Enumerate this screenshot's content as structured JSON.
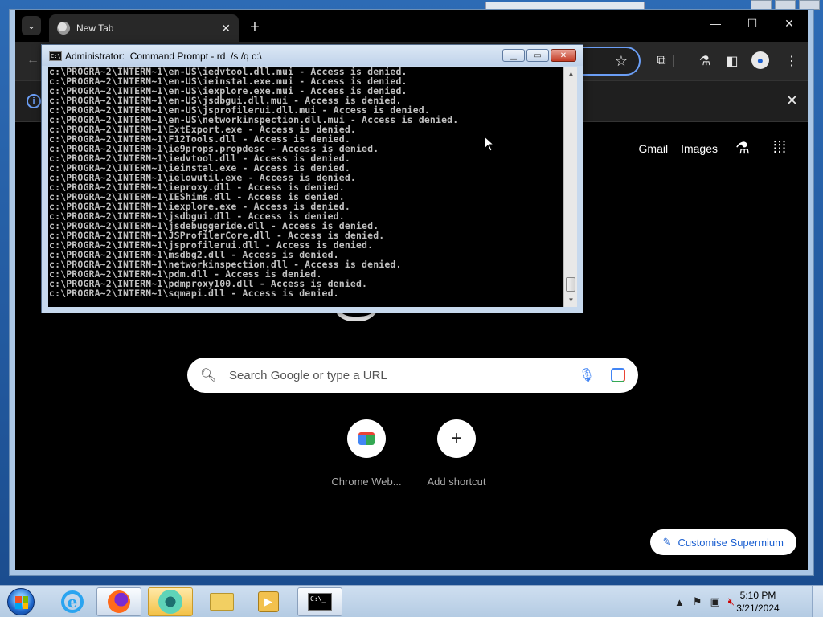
{
  "browser": {
    "tab_title": "New Tab",
    "window_controls": [
      "—",
      "☐",
      "✕"
    ],
    "links": {
      "gmail": "Gmail",
      "images": "Images"
    },
    "search_placeholder": "Search Google or type a URL",
    "shortcuts": [
      {
        "label": "Chrome Web..."
      },
      {
        "label": "Add shortcut"
      }
    ],
    "customise_label": "Customise Supermium"
  },
  "cmd": {
    "title": "Administrator:  Command Prompt - rd  /s /q c:\\",
    "lines": [
      "c:\\PROGRA~2\\INTERN~1\\en-US\\iedvtool.dll.mui - Access is denied.",
      "c:\\PROGRA~2\\INTERN~1\\en-US\\ieinstal.exe.mui - Access is denied.",
      "c:\\PROGRA~2\\INTERN~1\\en-US\\iexplore.exe.mui - Access is denied.",
      "c:\\PROGRA~2\\INTERN~1\\en-US\\jsdbgui.dll.mui - Access is denied.",
      "c:\\PROGRA~2\\INTERN~1\\en-US\\jsprofilerui.dll.mui - Access is denied.",
      "c:\\PROGRA~2\\INTERN~1\\en-US\\networkinspection.dll.mui - Access is denied.",
      "c:\\PROGRA~2\\INTERN~1\\ExtExport.exe - Access is denied.",
      "c:\\PROGRA~2\\INTERN~1\\F12Tools.dll - Access is denied.",
      "c:\\PROGRA~2\\INTERN~1\\ie9props.propdesc - Access is denied.",
      "c:\\PROGRA~2\\INTERN~1\\iedvtool.dll - Access is denied.",
      "c:\\PROGRA~2\\INTERN~1\\ieinstal.exe - Access is denied.",
      "c:\\PROGRA~2\\INTERN~1\\ielowutil.exe - Access is denied.",
      "c:\\PROGRA~2\\INTERN~1\\ieproxy.dll - Access is denied.",
      "c:\\PROGRA~2\\INTERN~1\\IEShims.dll - Access is denied.",
      "c:\\PROGRA~2\\INTERN~1\\iexplore.exe - Access is denied.",
      "c:\\PROGRA~2\\INTERN~1\\jsdbgui.dll - Access is denied.",
      "c:\\PROGRA~2\\INTERN~1\\jsdebuggeride.dll - Access is denied.",
      "c:\\PROGRA~2\\INTERN~1\\JSProfilerCore.dll - Access is denied.",
      "c:\\PROGRA~2\\INTERN~1\\jsprofilerui.dll - Access is denied.",
      "c:\\PROGRA~2\\INTERN~1\\msdbg2.dll - Access is denied.",
      "c:\\PROGRA~2\\INTERN~1\\networkinspection.dll - Access is denied.",
      "c:\\PROGRA~2\\INTERN~1\\pdm.dll - Access is denied.",
      "c:\\PROGRA~2\\INTERN~1\\pdmproxy100.dll - Access is denied.",
      "c:\\PROGRA~2\\INTERN~1\\sqmapi.dll - Access is denied."
    ]
  },
  "taskbar": {
    "time": "5:10 PM",
    "date": "3/21/2024"
  },
  "colors": {
    "omnibox_focus": "#6b9ef5",
    "customise_text": "#1a5fd1",
    "console_bg": "#000000",
    "console_text": "#c0c0c0"
  }
}
